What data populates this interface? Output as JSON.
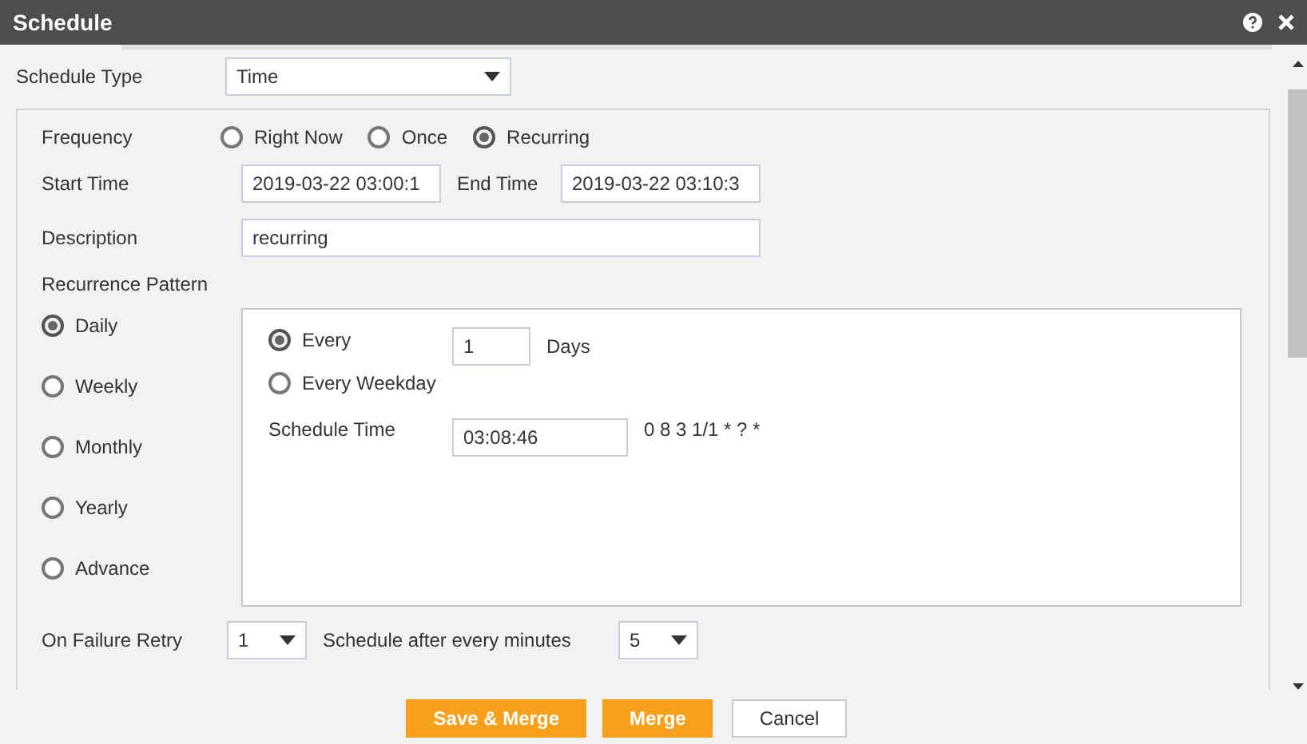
{
  "window": {
    "title": "Schedule"
  },
  "schedule_type": {
    "label": "Schedule Type",
    "value": "Time"
  },
  "frequency": {
    "label": "Frequency",
    "options": [
      {
        "label": "Right Now",
        "selected": false
      },
      {
        "label": "Once",
        "selected": false
      },
      {
        "label": "Recurring",
        "selected": true
      }
    ]
  },
  "start_time": {
    "label": "Start Time",
    "value": "2019-03-22 03:00:1"
  },
  "end_time": {
    "label": "End Time",
    "value": "2019-03-22 03:10:3"
  },
  "description": {
    "label": "Description",
    "value": "recurring"
  },
  "recurrence": {
    "label": "Recurrence Pattern",
    "options": [
      {
        "label": "Daily",
        "selected": true
      },
      {
        "label": "Weekly",
        "selected": false
      },
      {
        "label": "Monthly",
        "selected": false
      },
      {
        "label": "Yearly",
        "selected": false
      },
      {
        "label": "Advance",
        "selected": false
      }
    ],
    "every": {
      "label": "Every",
      "selected": true,
      "value": "1",
      "unit": "Days"
    },
    "every_weekday": {
      "label": "Every Weekday",
      "selected": false
    },
    "schedule_time": {
      "label": "Schedule Time",
      "value": "03:08:46",
      "cron": "0 8 3 1/1 * ? *"
    }
  },
  "retry": {
    "label": "On Failure Retry",
    "value": "1",
    "interval_label": "Schedule after every minutes",
    "interval_value": "5"
  },
  "buttons": [
    {
      "label": "Save & Merge",
      "kind": "primary"
    },
    {
      "label": "Merge",
      "kind": "primary"
    },
    {
      "label": "Cancel",
      "kind": "secondary"
    }
  ]
}
